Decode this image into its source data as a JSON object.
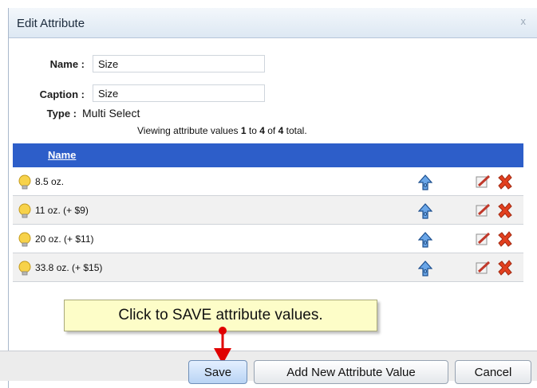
{
  "dialog": {
    "title": "Edit Attribute",
    "close_label": "x"
  },
  "form": {
    "name_label": "Name :",
    "name_value": "Size",
    "caption_label": "Caption :",
    "caption_value": "Size",
    "type_label": "Type :",
    "type_value": "Multi Select"
  },
  "viewing": {
    "prefix": "Viewing attribute values ",
    "from": "1",
    "to_word": " to ",
    "to": "4",
    "of_word": " of ",
    "total": "4",
    "suffix": " total."
  },
  "grid": {
    "header_name": "Name",
    "rows": [
      {
        "label": "8.5 oz."
      },
      {
        "label": "11 oz. (+ $9)"
      },
      {
        "label": "20 oz. (+ $11)"
      },
      {
        "label": "33.8 oz. (+ $15)"
      }
    ]
  },
  "callout": {
    "text": "Click to SAVE attribute values."
  },
  "buttons": {
    "save": "Save",
    "add_new": "Add New Attribute Value",
    "cancel": "Cancel"
  },
  "colors": {
    "header_blue": "#2d5ec9",
    "callout_yellow": "#fdfdc8",
    "arrow_red": "#e00000"
  },
  "icons": {
    "row_icon": "lightbulb-icon",
    "move_up": "move-up-arrow-icon",
    "edit": "edit-pencil-icon",
    "delete": "delete-x-icon"
  }
}
